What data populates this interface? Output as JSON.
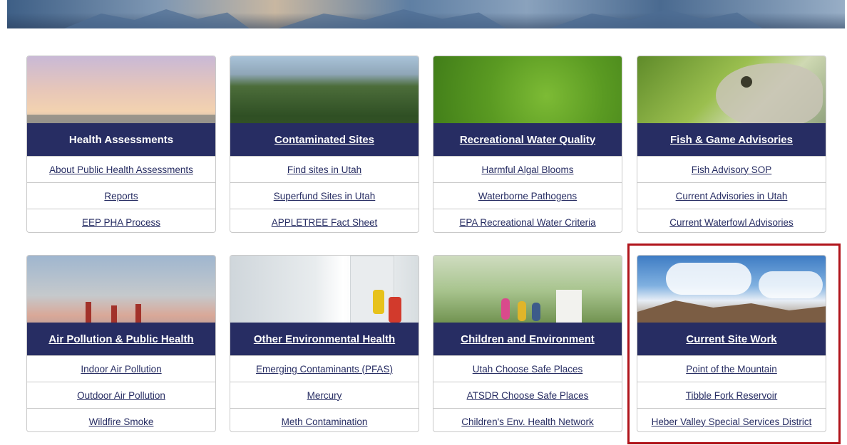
{
  "cards": [
    {
      "title": "Health Assessments",
      "links": [
        "About Public Health Assessments",
        "Reports",
        "EEP PHA Process"
      ]
    },
    {
      "title": "Contaminated Sites",
      "links": [
        "Find sites in Utah",
        "Superfund Sites in Utah",
        "APPLETREE Fact Sheet"
      ]
    },
    {
      "title": "Recreational Water Quality",
      "links": [
        "Harmful Algal Blooms",
        "Waterborne Pathogens",
        "EPA Recreational Water Criteria"
      ]
    },
    {
      "title": "Fish & Game Advisories",
      "links": [
        "Fish Advisory SOP",
        "Current Advisories in Utah",
        "Current Waterfowl Advisories"
      ]
    },
    {
      "title": "Air Pollution & Public Health",
      "links": [
        "Indoor Air Pollution",
        "Outdoor Air Pollution",
        "Wildfire Smoke"
      ]
    },
    {
      "title": "Other Environmental Health",
      "links": [
        "Emerging Contaminants (PFAS)",
        "Mercury",
        "Meth Contamination"
      ]
    },
    {
      "title": "Children and Environment",
      "links": [
        "Utah Choose Safe Places",
        "ATSDR Choose Safe Places",
        "Children's Env. Health Network"
      ]
    },
    {
      "title": "Current Site Work",
      "links": [
        "Point of the Mountain",
        "Tibble Fork Reservoir",
        "Heber Valley Special Services District"
      ]
    }
  ],
  "colors": {
    "caption_bg": "#272d63",
    "link": "#272d63",
    "highlight": "#b0141b"
  }
}
